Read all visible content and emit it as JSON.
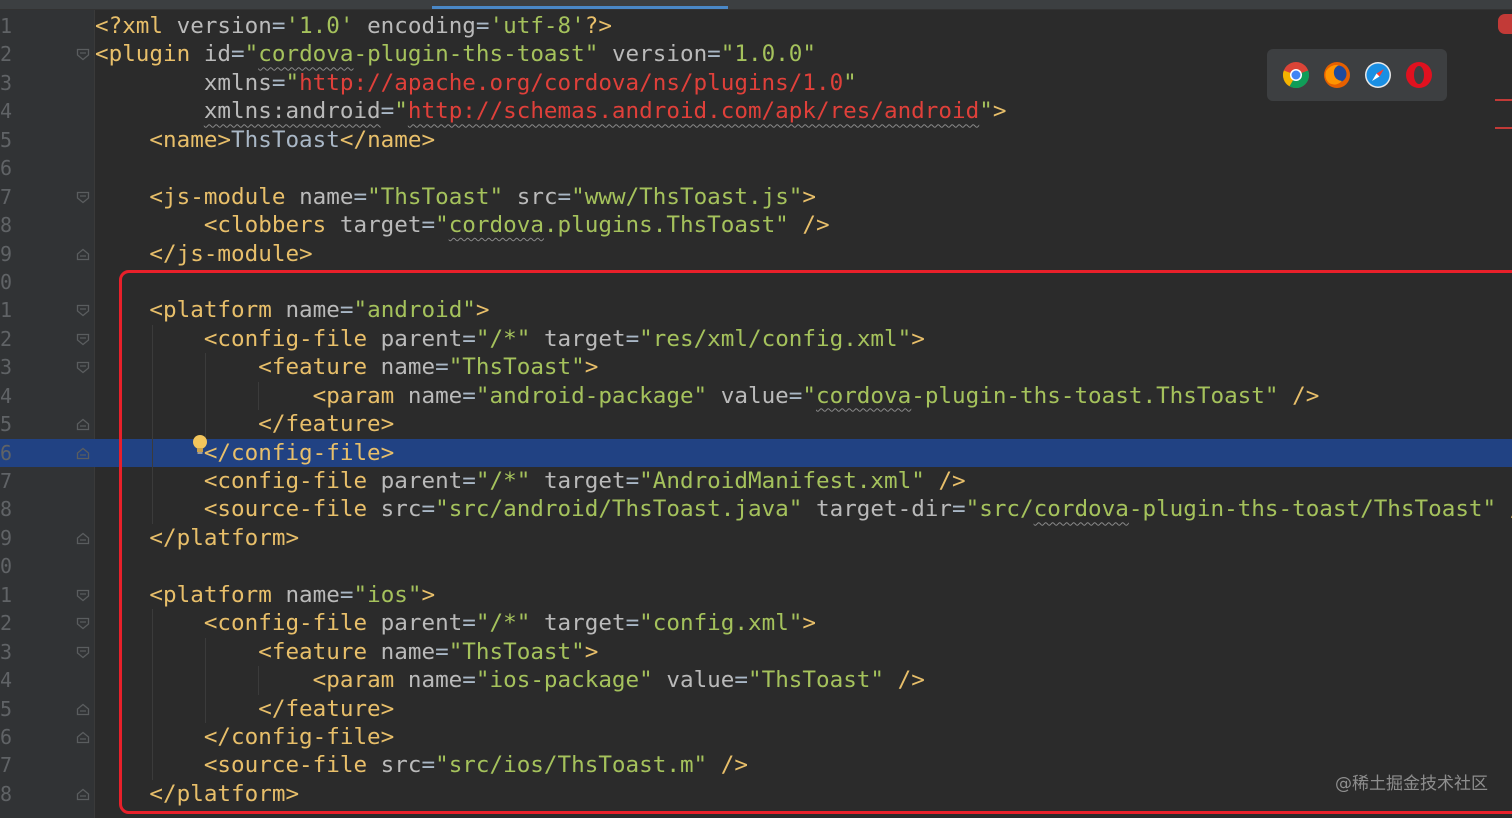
{
  "editor": {
    "line_numbers": [
      "1",
      "2",
      "3",
      "4",
      "5",
      "6",
      "7",
      "8",
      "9",
      "0",
      "1",
      "2",
      "3",
      "4",
      "5",
      "6",
      "7",
      "8",
      "9",
      "0",
      "1",
      "2",
      "3",
      "4",
      "5",
      "6",
      "7",
      "8"
    ],
    "selected_line_index": 15
  },
  "browser_icons": [
    {
      "icon": "chrome-icon"
    },
    {
      "icon": "firefox-icon"
    },
    {
      "icon": "safari-icon"
    },
    {
      "icon": "opera-icon"
    }
  ],
  "watermark": "@稀土掘金技术社区",
  "colors": {
    "background": "#2b2b2b",
    "tag": "#e8bf6a",
    "attribute": "#bababa",
    "value": "#a5c25c",
    "url": "#e0403a",
    "selection": "#214283",
    "highlight_box": "#e8202a"
  },
  "code": [
    {
      "indent": "",
      "tokens": [
        {
          "t": "pi",
          "v": "<?xml "
        },
        {
          "t": "attr",
          "v": "version"
        },
        {
          "t": "text",
          "v": "="
        },
        {
          "t": "val",
          "v": "'1.0'"
        },
        {
          "t": "text",
          "v": " "
        },
        {
          "t": "attr",
          "v": "encoding"
        },
        {
          "t": "text",
          "v": "="
        },
        {
          "t": "val",
          "v": "'utf-8'"
        },
        {
          "t": "pi",
          "v": "?>"
        }
      ]
    },
    {
      "indent": "",
      "tokens": [
        {
          "t": "tag",
          "v": "<plugin "
        },
        {
          "t": "attr",
          "v": "id"
        },
        {
          "t": "text",
          "v": "="
        },
        {
          "t": "val",
          "v": "\""
        },
        {
          "t": "val",
          "v": "cordova",
          "sq": true
        },
        {
          "t": "val",
          "v": "-plugin-ths-toast\""
        },
        {
          "t": "text",
          "v": " "
        },
        {
          "t": "attr",
          "v": "version"
        },
        {
          "t": "text",
          "v": "="
        },
        {
          "t": "val",
          "v": "\"1.0.0\""
        }
      ]
    },
    {
      "indent": "        ",
      "tokens": [
        {
          "t": "attr",
          "v": "xmlns"
        },
        {
          "t": "text",
          "v": "="
        },
        {
          "t": "val",
          "v": "\""
        },
        {
          "t": "url",
          "v": "http://apache.org/cordova/ns/plugins/1.0"
        },
        {
          "t": "val",
          "v": "\""
        }
      ]
    },
    {
      "indent": "        ",
      "tokens": [
        {
          "t": "attr",
          "v": "xmlns:android",
          "sq": true
        },
        {
          "t": "text",
          "v": "="
        },
        {
          "t": "val",
          "v": "\""
        },
        {
          "t": "url",
          "v": "http://schemas.android.com/apk/res/android",
          "sq": true
        },
        {
          "t": "val",
          "v": "\""
        },
        {
          "t": "tag",
          "v": ">"
        }
      ]
    },
    {
      "indent": "    ",
      "tokens": [
        {
          "t": "tag",
          "v": "<name>"
        },
        {
          "t": "text",
          "v": "ThsToast"
        },
        {
          "t": "tag",
          "v": "</name>"
        }
      ]
    },
    {
      "indent": "",
      "tokens": []
    },
    {
      "indent": "    ",
      "tokens": [
        {
          "t": "tag",
          "v": "<js-module "
        },
        {
          "t": "attr",
          "v": "name"
        },
        {
          "t": "text",
          "v": "="
        },
        {
          "t": "val",
          "v": "\"ThsToast\""
        },
        {
          "t": "text",
          "v": " "
        },
        {
          "t": "attr",
          "v": "src"
        },
        {
          "t": "text",
          "v": "="
        },
        {
          "t": "val",
          "v": "\"www/ThsToast.js\""
        },
        {
          "t": "tag",
          "v": ">"
        }
      ]
    },
    {
      "indent": "        ",
      "tokens": [
        {
          "t": "tag",
          "v": "<clobbers "
        },
        {
          "t": "attr",
          "v": "target"
        },
        {
          "t": "text",
          "v": "="
        },
        {
          "t": "val",
          "v": "\""
        },
        {
          "t": "val",
          "v": "cordova",
          "sq": true
        },
        {
          "t": "val",
          "v": ".plugins.ThsToast\""
        },
        {
          "t": "text",
          "v": " "
        },
        {
          "t": "tag",
          "v": "/>"
        }
      ]
    },
    {
      "indent": "    ",
      "tokens": [
        {
          "t": "tag",
          "v": "</js-module>"
        }
      ]
    },
    {
      "indent": "",
      "tokens": []
    },
    {
      "indent": "    ",
      "tokens": [
        {
          "t": "tag",
          "v": "<platform "
        },
        {
          "t": "attr",
          "v": "name"
        },
        {
          "t": "text",
          "v": "="
        },
        {
          "t": "val",
          "v": "\"android\""
        },
        {
          "t": "tag",
          "v": ">"
        }
      ]
    },
    {
      "indent": "        ",
      "tokens": [
        {
          "t": "tag",
          "v": "<config-file "
        },
        {
          "t": "attr",
          "v": "parent"
        },
        {
          "t": "text",
          "v": "="
        },
        {
          "t": "val",
          "v": "\"/*\""
        },
        {
          "t": "text",
          "v": " "
        },
        {
          "t": "attr",
          "v": "target"
        },
        {
          "t": "text",
          "v": "="
        },
        {
          "t": "val",
          "v": "\"res/xml/config.xml\""
        },
        {
          "t": "tag",
          "v": ">"
        }
      ]
    },
    {
      "indent": "            ",
      "tokens": [
        {
          "t": "tag",
          "v": "<feature "
        },
        {
          "t": "attr",
          "v": "name"
        },
        {
          "t": "text",
          "v": "="
        },
        {
          "t": "val",
          "v": "\"ThsToast\""
        },
        {
          "t": "tag",
          "v": ">"
        }
      ]
    },
    {
      "indent": "                ",
      "tokens": [
        {
          "t": "tag",
          "v": "<param "
        },
        {
          "t": "attr",
          "v": "name"
        },
        {
          "t": "text",
          "v": "="
        },
        {
          "t": "val",
          "v": "\"android-package\""
        },
        {
          "t": "text",
          "v": " "
        },
        {
          "t": "attr",
          "v": "value"
        },
        {
          "t": "text",
          "v": "="
        },
        {
          "t": "val",
          "v": "\""
        },
        {
          "t": "val",
          "v": "cordova",
          "sq": true
        },
        {
          "t": "val",
          "v": "-plugin-ths-toast.ThsToast\""
        },
        {
          "t": "text",
          "v": " "
        },
        {
          "t": "tag",
          "v": "/>"
        }
      ]
    },
    {
      "indent": "            ",
      "tokens": [
        {
          "t": "tag",
          "v": "</feature>"
        }
      ]
    },
    {
      "indent": "        ",
      "tokens": [
        {
          "t": "tag",
          "v": "</config-file>"
        }
      ]
    },
    {
      "indent": "        ",
      "tokens": [
        {
          "t": "tag",
          "v": "<config-file "
        },
        {
          "t": "attr",
          "v": "parent"
        },
        {
          "t": "text",
          "v": "="
        },
        {
          "t": "val",
          "v": "\"/*\""
        },
        {
          "t": "text",
          "v": " "
        },
        {
          "t": "attr",
          "v": "target"
        },
        {
          "t": "text",
          "v": "="
        },
        {
          "t": "val",
          "v": "\"AndroidManifest.xml\""
        },
        {
          "t": "text",
          "v": " "
        },
        {
          "t": "tag",
          "v": "/>"
        }
      ]
    },
    {
      "indent": "        ",
      "tokens": [
        {
          "t": "tag",
          "v": "<source-file "
        },
        {
          "t": "attr",
          "v": "src"
        },
        {
          "t": "text",
          "v": "="
        },
        {
          "t": "val",
          "v": "\"src/android/ThsToast.java\""
        },
        {
          "t": "text",
          "v": " "
        },
        {
          "t": "attr",
          "v": "target-dir"
        },
        {
          "t": "text",
          "v": "="
        },
        {
          "t": "val",
          "v": "\"src/"
        },
        {
          "t": "val",
          "v": "cordova",
          "sq": true
        },
        {
          "t": "val",
          "v": "-plugin-ths-toast/ThsToast\""
        },
        {
          "t": "text",
          "v": " "
        },
        {
          "t": "tag",
          "v": "/>"
        }
      ]
    },
    {
      "indent": "    ",
      "tokens": [
        {
          "t": "tag",
          "v": "</platform>"
        }
      ]
    },
    {
      "indent": "",
      "tokens": []
    },
    {
      "indent": "    ",
      "tokens": [
        {
          "t": "tag",
          "v": "<platform "
        },
        {
          "t": "attr",
          "v": "name"
        },
        {
          "t": "text",
          "v": "="
        },
        {
          "t": "val",
          "v": "\"ios\""
        },
        {
          "t": "tag",
          "v": ">"
        }
      ]
    },
    {
      "indent": "        ",
      "tokens": [
        {
          "t": "tag",
          "v": "<config-file "
        },
        {
          "t": "attr",
          "v": "parent"
        },
        {
          "t": "text",
          "v": "="
        },
        {
          "t": "val",
          "v": "\"/*\""
        },
        {
          "t": "text",
          "v": " "
        },
        {
          "t": "attr",
          "v": "target"
        },
        {
          "t": "text",
          "v": "="
        },
        {
          "t": "val",
          "v": "\"config.xml\""
        },
        {
          "t": "tag",
          "v": ">"
        }
      ]
    },
    {
      "indent": "            ",
      "tokens": [
        {
          "t": "tag",
          "v": "<feature "
        },
        {
          "t": "attr",
          "v": "name"
        },
        {
          "t": "text",
          "v": "="
        },
        {
          "t": "val",
          "v": "\"ThsToast\""
        },
        {
          "t": "tag",
          "v": ">"
        }
      ]
    },
    {
      "indent": "                ",
      "tokens": [
        {
          "t": "tag",
          "v": "<param "
        },
        {
          "t": "attr",
          "v": "name"
        },
        {
          "t": "text",
          "v": "="
        },
        {
          "t": "val",
          "v": "\"ios-package\""
        },
        {
          "t": "text",
          "v": " "
        },
        {
          "t": "attr",
          "v": "value"
        },
        {
          "t": "text",
          "v": "="
        },
        {
          "t": "val",
          "v": "\"ThsToast\""
        },
        {
          "t": "text",
          "v": " "
        },
        {
          "t": "tag",
          "v": "/>"
        }
      ]
    },
    {
      "indent": "            ",
      "tokens": [
        {
          "t": "tag",
          "v": "</feature>"
        }
      ]
    },
    {
      "indent": "        ",
      "tokens": [
        {
          "t": "tag",
          "v": "</config-file>"
        }
      ]
    },
    {
      "indent": "        ",
      "tokens": [
        {
          "t": "tag",
          "v": "<source-file "
        },
        {
          "t": "attr",
          "v": "src"
        },
        {
          "t": "text",
          "v": "="
        },
        {
          "t": "val",
          "v": "\"src/ios/ThsToast.m\""
        },
        {
          "t": "text",
          "v": " "
        },
        {
          "t": "tag",
          "v": "/>"
        }
      ]
    },
    {
      "indent": "    ",
      "tokens": [
        {
          "t": "tag",
          "v": "</platform>"
        }
      ]
    }
  ]
}
